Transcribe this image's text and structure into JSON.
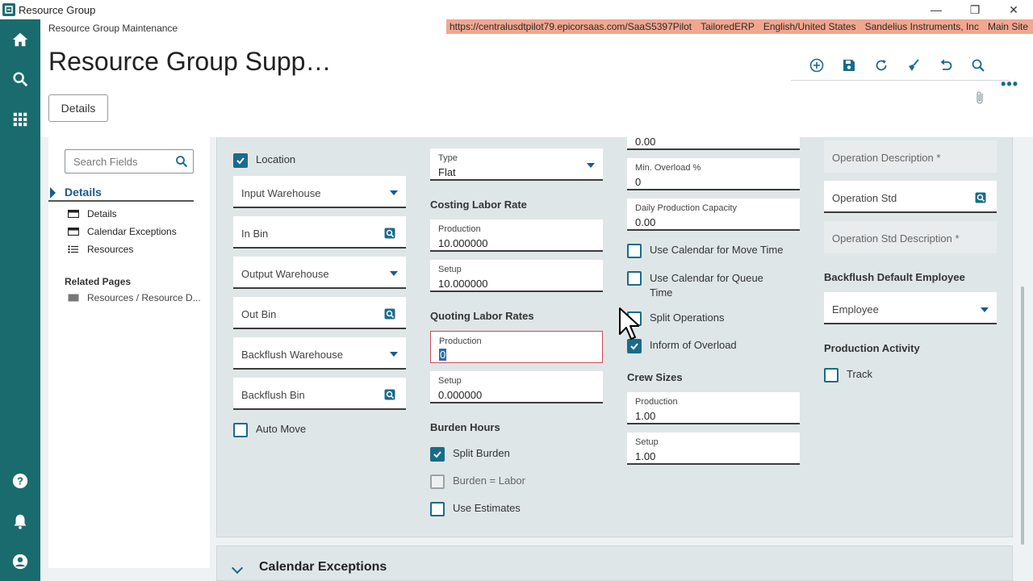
{
  "window": {
    "title": "Resource Group",
    "minimize": "—",
    "restore": "❐",
    "close": "✕"
  },
  "header": {
    "breadcrumb": "Resource Group Maintenance",
    "env": [
      "https://centralusdtpilot79.epicorsaas.com/SaaS5397Pilot",
      "TailoredERP",
      "English/United States",
      "Sandelius Instruments, Inc",
      "Main Site"
    ],
    "title": "Resource Group Supp…",
    "more": "•••",
    "details_tab": "Details"
  },
  "sidebar": {
    "search_placeholder": "Search Fields",
    "nav_head": "Details",
    "items": [
      {
        "label": "Details"
      },
      {
        "label": "Calendar Exceptions"
      },
      {
        "label": "Resources"
      }
    ],
    "related_head": "Related Pages",
    "related_item": "Resources / Resource D..."
  },
  "col1": {
    "location_label": "Location",
    "input_warehouse": "Input Warehouse",
    "in_bin": "In Bin",
    "output_warehouse": "Output Warehouse",
    "out_bin": "Out Bin",
    "backflush_warehouse": "Backflush Warehouse",
    "backflush_bin": "Backflush Bin",
    "auto_move": "Auto Move"
  },
  "col2": {
    "type_label": "Type",
    "type_value": "Flat",
    "costing_title": "Costing Labor Rate",
    "costing_prod_label": "Production",
    "costing_prod_value": "10.000000",
    "costing_setup_label": "Setup",
    "costing_setup_value": "10.000000",
    "quoting_title": "Quoting Labor Rates",
    "quoting_prod_label": "Production",
    "quoting_prod_value": "0",
    "quoting_setup_label": "Setup",
    "quoting_setup_value": "0.000000",
    "burden_title": "Burden Hours",
    "split_burden": "Split Burden",
    "burden_labor": "Burden = Labor",
    "use_estimates": "Use Estimates"
  },
  "col3": {
    "top_value": "0.00",
    "min_overload_label": "Min. Overload %",
    "min_overload_value": "0",
    "daily_cap_label": "Daily Production Capacity",
    "daily_cap_value": "0.00",
    "cal_move": "Use Calendar for Move Time",
    "cal_queue": "Use Calendar for Queue Time",
    "split_ops": "Split Operations",
    "inform_overload": "Inform of Overload",
    "crew_title": "Crew Sizes",
    "crew_prod_label": "Production",
    "crew_prod_value": "1.00",
    "crew_setup_label": "Setup",
    "crew_setup_value": "1.00"
  },
  "col4": {
    "op_desc": "Operation Description *",
    "op_std": "Operation Std",
    "op_std_desc": "Operation Std Description *",
    "backflush_emp_title": "Backflush Default Employee",
    "employee": "Employee",
    "prod_activity_title": "Production Activity",
    "track": "Track"
  },
  "bottom": {
    "title": "Calendar Exceptions"
  },
  "colors": {
    "rail": "#1a6b6e",
    "accent": "#1a6b8a",
    "env_bar": "#f1a68f",
    "card": "#dfe6e8"
  }
}
